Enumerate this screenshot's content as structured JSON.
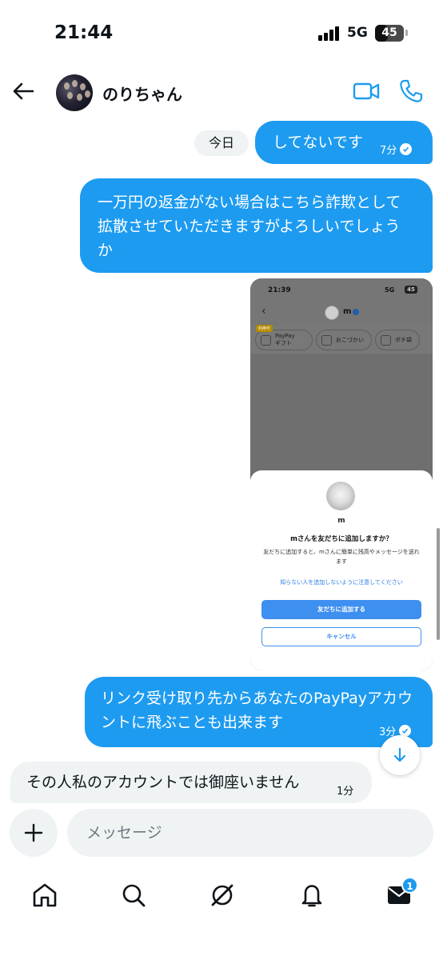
{
  "status_bar": {
    "time": "21:44",
    "network": "5G",
    "battery": "45",
    "battery_level": 0.45
  },
  "header": {
    "contact_name": "のりちゃん"
  },
  "chat": {
    "date_label": "今日",
    "messages": [
      {
        "direction": "out",
        "text": "してないです",
        "time": "7分",
        "read": true
      },
      {
        "direction": "out",
        "text": "一万円の返金がない場合はこちら詐欺として拡散させていただきますがよろしいでしょうか"
      },
      {
        "direction": "out",
        "type": "image"
      },
      {
        "direction": "out",
        "text": "リンク受け取り先からあなたのPayPayアカウントに飛ぶことも出来ます",
        "time": "3分",
        "read": true
      },
      {
        "direction": "in",
        "text": "その人私のアカウントでは御座いません",
        "time": "1分"
      }
    ]
  },
  "screenshot": {
    "time": "21:39",
    "network": "5G",
    "battery": "45",
    "contact_name": "m",
    "chips": [
      {
        "badge": "利用可",
        "label": "PayPay\nギフト"
      },
      {
        "label": "おこづかい"
      },
      {
        "label": "ポチ袋"
      }
    ],
    "sheet": {
      "name": "m",
      "question": "mさんを友だちに追加しますか？",
      "description": "友だちに追加すると、mさんに簡単に残高やメッセージを送れます",
      "warning": "知らない人を追加しないように注意してください",
      "add_button": "友だちに追加する",
      "cancel_button": "キャンセル"
    }
  },
  "composer": {
    "placeholder": "メッセージ"
  },
  "tabbar": {
    "messages_badge": "1"
  },
  "colors": {
    "accent": "#1d9bf0",
    "bubble_in": "#eff3f4"
  }
}
